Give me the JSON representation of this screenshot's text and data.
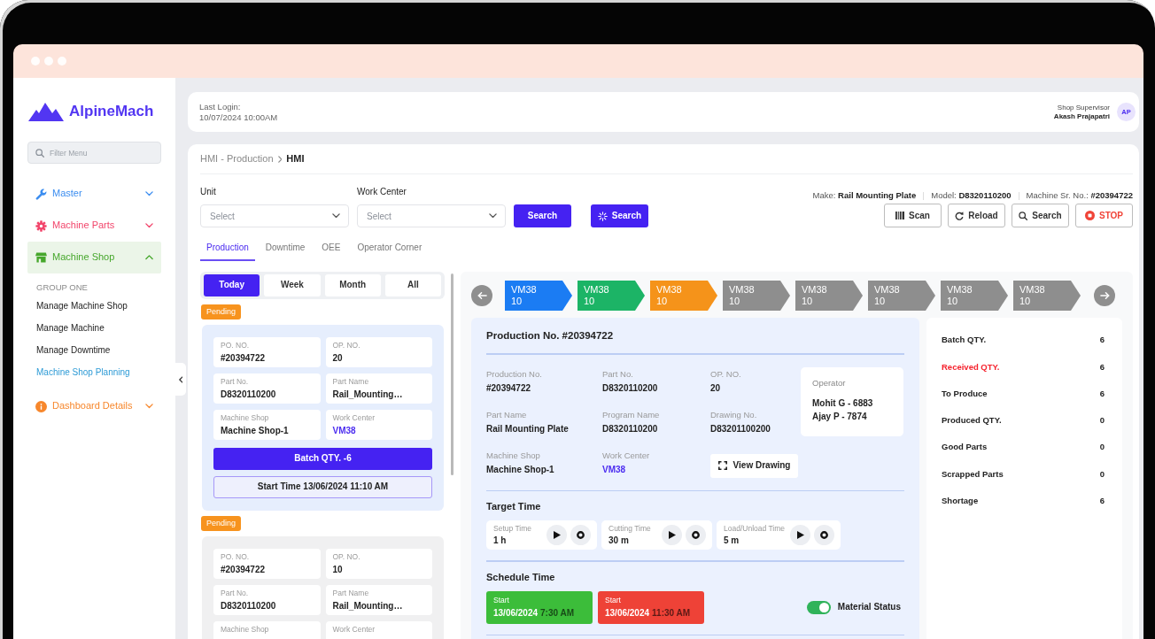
{
  "sidebar": {
    "logo": "AlpineMach",
    "filter": {
      "placeholder": "Filter Menu"
    },
    "items": [
      {
        "label": "Master",
        "kind": "wrench",
        "color": "#3b8df0",
        "selected": false,
        "expanded": false
      },
      {
        "label": "Machine Parts",
        "kind": "gear",
        "color": "#f2456b",
        "selected": false,
        "expanded": false
      },
      {
        "label": "Machine Shop",
        "kind": "store",
        "color": "#46a72c",
        "selected": true,
        "expanded": true,
        "group": "GROUP ONE",
        "children": [
          {
            "label": "Manage Machine Shop",
            "selected": false
          },
          {
            "label": "Manage Machine",
            "selected": false
          },
          {
            "label": "Manage Downtime",
            "selected": false
          },
          {
            "label": "Machine Shop Planning",
            "selected": true
          }
        ]
      },
      {
        "label": "Dashboard Details",
        "kind": "info",
        "color": "#f7872c",
        "selected": false,
        "expanded": false
      }
    ]
  },
  "header": {
    "last_login_label": "Last Login:",
    "last_login": "10/07/2024 10:00AM",
    "role": "Shop Supervisor",
    "user": "Akash Prajapatri",
    "initials": "AP"
  },
  "breadcrumb": [
    "HMI - Production",
    "HMI"
  ],
  "filters": [
    {
      "label": "Unit",
      "placeholder": "Select"
    },
    {
      "label": "Work Center",
      "placeholder": "Select"
    }
  ],
  "search_buttons": [
    {
      "label": "Search",
      "kind": "plain"
    },
    {
      "label": "Search",
      "kind": "loading"
    }
  ],
  "machine_info": [
    {
      "label": "Make:",
      "value": "Rail Mounting Plate"
    },
    {
      "label": "Model:",
      "value": "D8320110200"
    },
    {
      "label": "Machine Sr. No.:",
      "value": "#20394722"
    }
  ],
  "actions": [
    {
      "label": "Scan",
      "kind": "scan"
    },
    {
      "label": "Reload",
      "kind": "reload"
    },
    {
      "label": "Search",
      "kind": "search"
    },
    {
      "label": "STOP",
      "kind": "stop"
    }
  ],
  "tabs": [
    {
      "label": "Production",
      "selected": true
    },
    {
      "label": "Downtime",
      "selected": false
    },
    {
      "label": "OEE",
      "selected": false
    },
    {
      "label": "Operator Corner",
      "selected": false
    }
  ],
  "periods": [
    {
      "label": "Today",
      "selected": true
    },
    {
      "label": "Week",
      "selected": false
    },
    {
      "label": "Month",
      "selected": false
    },
    {
      "label": "All",
      "selected": false
    }
  ],
  "orders": [
    {
      "status": "Pending",
      "selected": true,
      "fields": [
        {
          "label": "PO. NO.",
          "value": "#20394722",
          "kind": "text"
        },
        {
          "label": "OP. NO.",
          "value": "20",
          "kind": "text"
        },
        {
          "label": "Part No.",
          "value": "D8320110200",
          "kind": "text"
        },
        {
          "label": "Part Name",
          "value": "Rail_Mounting…",
          "kind": "text"
        },
        {
          "label": "Machine Shop",
          "value": "Machine Shop-1",
          "kind": "text"
        },
        {
          "label": "Work Center",
          "value": "VM38",
          "kind": "link"
        }
      ],
      "batch": "Batch QTY. -6",
      "start_time": "Start Time 13/06/2024 11:10 AM"
    },
    {
      "status": "Pending",
      "selected": false,
      "fields": [
        {
          "label": "PO. NO.",
          "value": "#20394722",
          "kind": "text"
        },
        {
          "label": "OP. NO.",
          "value": "10",
          "kind": "text"
        },
        {
          "label": "Part No.",
          "value": "D8320110200",
          "kind": "text"
        },
        {
          "label": "Part Name",
          "value": "Rail_Mounting…",
          "kind": "text"
        },
        {
          "label": "Machine Shop"
        },
        {
          "label": "Work Center"
        }
      ]
    }
  ],
  "stages": [
    {
      "code": "VM38",
      "op": "10",
      "color": "#1b7cf3"
    },
    {
      "code": "VM38",
      "op": "10",
      "color": "#1cb466"
    },
    {
      "code": "VM38",
      "op": "10",
      "color": "#f5931a"
    },
    {
      "code": "VM38",
      "op": "10",
      "color": "#8e8e8e"
    },
    {
      "code": "VM38",
      "op": "10",
      "color": "#8e8e8e"
    },
    {
      "code": "VM38",
      "op": "10",
      "color": "#8e8e8e"
    },
    {
      "code": "VM38",
      "op": "10",
      "color": "#8e8e8e"
    },
    {
      "code": "VM38",
      "op": "10",
      "color": "#8e8e8e"
    }
  ],
  "production": {
    "title": "Production No. #20394722",
    "fields": [
      {
        "label": "Production No.",
        "value": "#20394722",
        "kind": "text"
      },
      {
        "label": "Part No.",
        "value": "D8320110200",
        "kind": "text"
      },
      {
        "label": "OP. NO.",
        "value": "20",
        "kind": "text"
      },
      {
        "label": "Part Name",
        "value": "Rail Mounting Plate",
        "kind": "text"
      },
      {
        "label": "Program Name",
        "value": "D8320110200",
        "kind": "text"
      },
      {
        "label": "Drawing No.",
        "value": "D83201100200",
        "kind": "text"
      },
      {
        "label": "Machine Shop",
        "value": "Machine Shop-1",
        "kind": "text"
      },
      {
        "label": "Work Center",
        "value": "VM38",
        "kind": "link"
      }
    ],
    "operator": {
      "label": "Operator",
      "names": [
        "Mohit G - 6883",
        "Ajay P - 7874"
      ]
    },
    "view_drawing": "View Drawing",
    "target": {
      "title": "Target Time",
      "timers": [
        {
          "label": "Setup Time",
          "value": "1 h"
        },
        {
          "label": "Cutting Time",
          "value": "30 m"
        },
        {
          "label": "Load/Unload Time",
          "value": "5 m"
        }
      ]
    },
    "schedule": {
      "title": "Schedule Time",
      "slots": [
        {
          "label": "Start",
          "date": "13/06/2024",
          "time": "7:30 AM",
          "color": "#3cbd3a"
        },
        {
          "label": "Start",
          "date": "13/06/2024",
          "time": "11:30 AM",
          "color": "#ee4237"
        }
      ]
    },
    "material_status": {
      "label": "Material Status",
      "on": true
    }
  },
  "summary": [
    {
      "label": "Batch QTY.",
      "value": "6",
      "alert": false
    },
    {
      "label": "Received QTY.",
      "value": "6",
      "alert": true
    },
    {
      "label": "To Produce",
      "value": "6",
      "alert": false
    },
    {
      "label": "Produced QTY.",
      "value": "0",
      "alert": false
    },
    {
      "label": "Good Parts",
      "value": "0",
      "alert": false
    },
    {
      "label": "Scrapped Parts",
      "value": "0",
      "alert": false
    },
    {
      "label": "Shortage",
      "value": "6",
      "alert": false
    }
  ]
}
